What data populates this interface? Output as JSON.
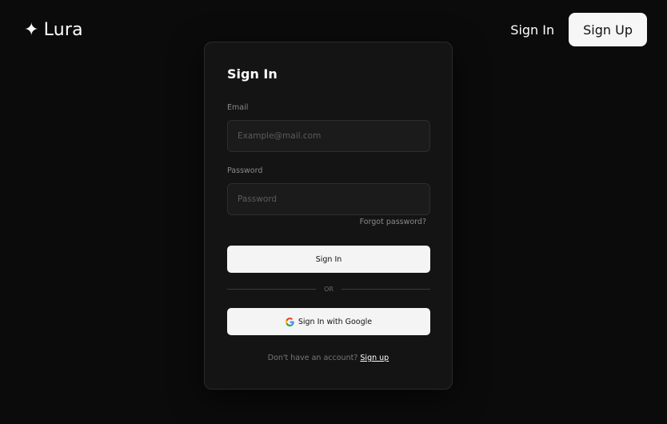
{
  "header": {
    "brand_icon": "✦",
    "brand_name": "Lura",
    "nav_sign_in": "Sign In",
    "nav_sign_up": "Sign Up"
  },
  "card": {
    "title": "Sign In",
    "email": {
      "label": "Email",
      "placeholder": "Example@mail.com",
      "value": ""
    },
    "password": {
      "label": "Password",
      "placeholder": "Password",
      "value": ""
    },
    "forgot_password": "Forgot password?",
    "sign_in_button": "Sign In",
    "divider_text": "OR",
    "google_button": "Sign In with Google",
    "footer_prompt": "Don't have an account?",
    "footer_link": "Sign up"
  },
  "colors": {
    "background": "#0b0b0b",
    "card": "#141414",
    "button_light": "#f4f4f4"
  },
  "icons": {
    "brand": "sparkle-icon",
    "google": "google-icon"
  }
}
